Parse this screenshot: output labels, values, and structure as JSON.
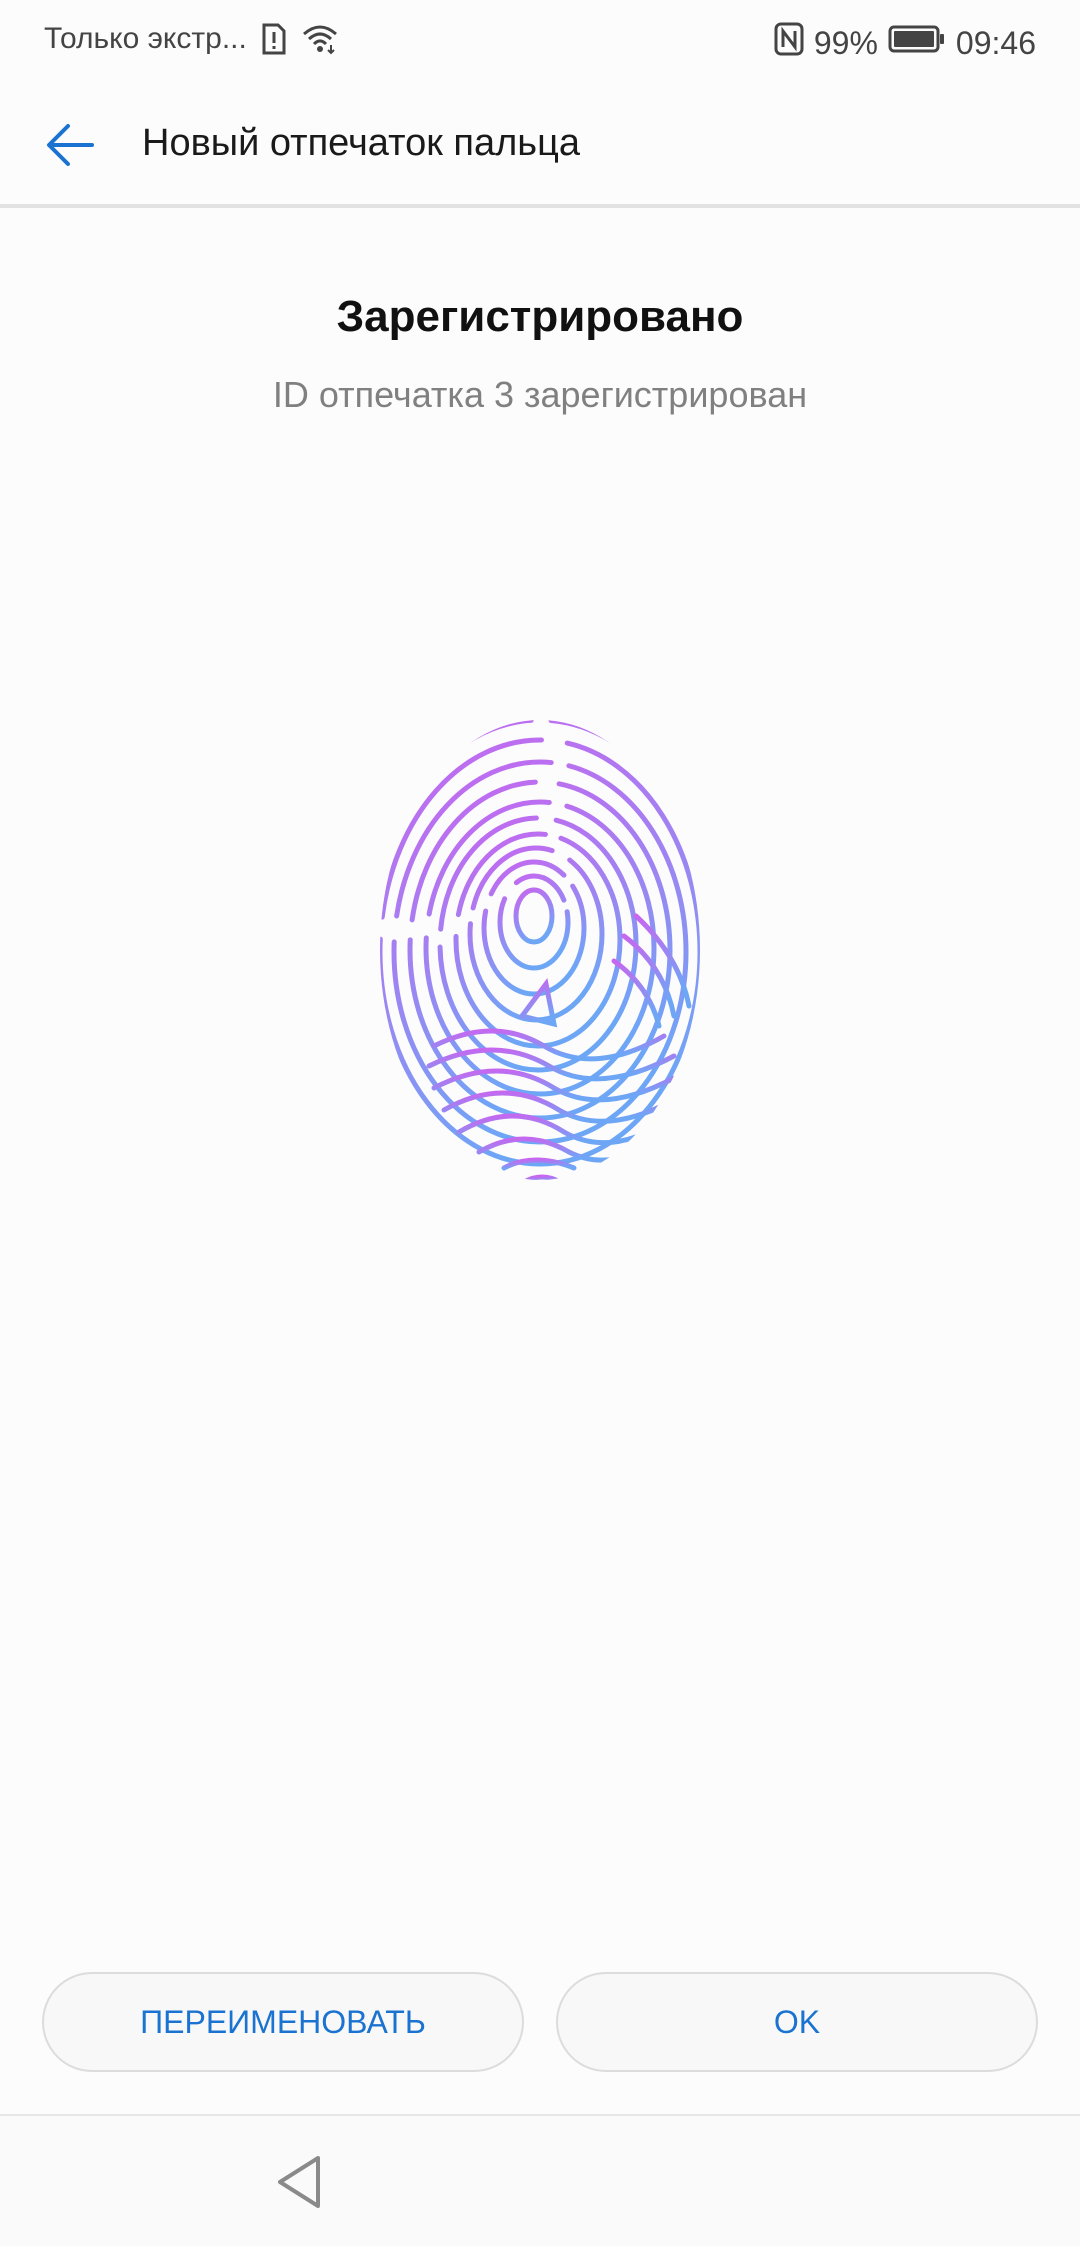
{
  "status_bar": {
    "carrier": "Только экстр...",
    "battery": "99%",
    "time": "09:46"
  },
  "header": {
    "title": "Новый отпечаток пальца"
  },
  "main": {
    "heading": "Зарегистрировано",
    "subheading": "ID отпечатка 3 зарегистрирован"
  },
  "actions": {
    "rename_label": "ПЕРЕИМЕНОВАТЬ",
    "ok_label": "OK"
  },
  "colors": {
    "accent": "#1a73d0",
    "fingerprint_top": "#c466ee",
    "fingerprint_bottom": "#6fa3f5"
  },
  "icons": {
    "back": "arrow-left-icon",
    "nfc": "nfc-icon",
    "wifi": "wifi-icon",
    "sim_alert": "sim-alert-icon",
    "battery": "battery-icon",
    "nav_back": "triangle-back-icon"
  }
}
